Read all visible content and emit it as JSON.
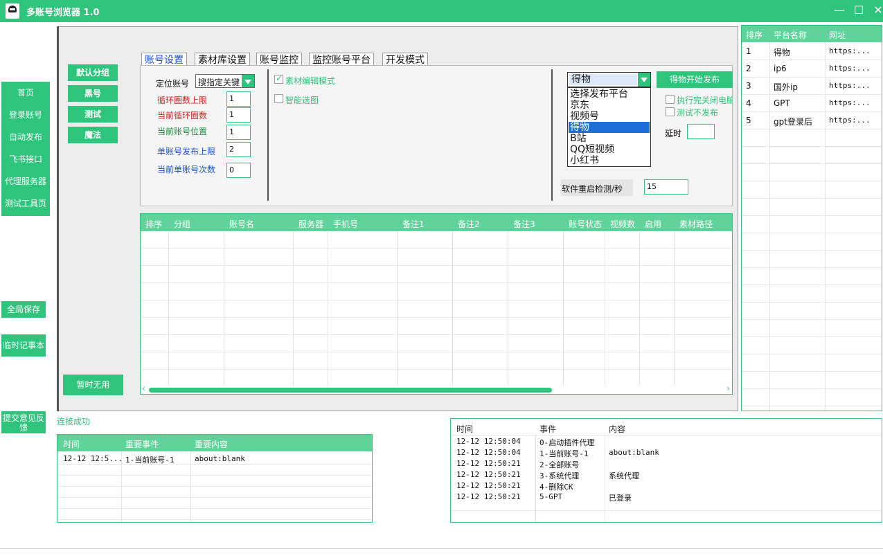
{
  "app": {
    "title": "多账号浏览器 1.0",
    "colors": {
      "accent": "#2ec47c",
      "header": "#5fd39a",
      "red": "#e02020",
      "blue": "#1a4fd8",
      "green_text": "#1e8a3c"
    },
    "window_controls": {
      "minimize": "—",
      "maximize": "☐",
      "close": "✕"
    }
  },
  "nav": {
    "items": [
      "首页",
      "登录账号",
      "自动发布",
      "飞书接口",
      "代理服务器",
      "测试工具页"
    ],
    "global_save": "全局保存",
    "temp_notes": "临时记事本",
    "feedback": "提交意见反馈",
    "unused": "暂时无用"
  },
  "groups": [
    "默认分组",
    "黑号",
    "测试",
    "魔法"
  ],
  "tabs": [
    "账号设置",
    "素材库设置",
    "账号监控",
    "监控账号平台",
    "开发模式"
  ],
  "settings": {
    "locate_account_label": "定位账号",
    "locate_select_value": "搜指定关键",
    "loop_limit_label": "循环圈数上限",
    "loop_limit_value": "1",
    "current_loop_label": "当前循环圈数",
    "current_loop_value": "1",
    "current_account_pos_label": "当前账号位置",
    "current_account_pos_value": "1",
    "single_publish_limit_label": "单账号发布上限",
    "single_publish_limit_value": "2",
    "current_single_count_label": "当前单账号次数",
    "current_single_count_value": "0",
    "material_edit_mode": "素材编辑模式",
    "material_edit_checked": true,
    "smart_select": "智能选图",
    "smart_select_checked": false,
    "platform_selected": "得物",
    "platform_options": [
      "选择发布平台",
      "京东",
      "视频号",
      "得物",
      "B站",
      "QQ短视频",
      "小红书"
    ],
    "publish_button": "得物开始发布",
    "close_after": "执行完关闭电脑",
    "test_no_publish": "测试不发布",
    "delay_label": "延时",
    "delay_value": "",
    "restart_check_label": "软件重启检测/秒",
    "restart_check_value": "15"
  },
  "account_table": {
    "columns": [
      "排序",
      "分组",
      "账号名",
      "服务器",
      "手机号",
      "备注1",
      "备注2",
      "备注3",
      "账号状态",
      "视频数",
      "启用",
      "素材路径"
    ],
    "rows": []
  },
  "platform_table": {
    "columns": [
      "排序",
      "平台名称",
      "网址"
    ],
    "rows": [
      [
        "1",
        "得物",
        "https:..."
      ],
      [
        "2",
        "ip6",
        "https:..."
      ],
      [
        "3",
        "国外ip",
        "https:..."
      ],
      [
        "4",
        "GPT",
        "https:..."
      ],
      [
        "5",
        "gpt登录后",
        "https:..."
      ]
    ]
  },
  "status": "连接成功",
  "log_left": {
    "columns": [
      "时间",
      "重要事件",
      "重要内容"
    ],
    "rows": [
      [
        "12-12 12:5...",
        "1-当前账号-1",
        "about:blank"
      ]
    ]
  },
  "log_right": {
    "columns": [
      "时间",
      "事件",
      "内容"
    ],
    "rows": [
      [
        "12-12 12:50:04",
        "0-启动插件代理",
        ""
      ],
      [
        "12-12 12:50:04",
        "1-当前账号-1",
        "about:blank"
      ],
      [
        "12-12 12:50:21",
        "2-全部账号",
        ""
      ],
      [
        "12-12 12:50:21",
        "3-系统代理",
        "系统代理"
      ],
      [
        "12-12 12:50:21",
        "4-删除CK",
        ""
      ],
      [
        "12-12 12:50:21",
        "5-GPT",
        "已登录"
      ]
    ]
  }
}
